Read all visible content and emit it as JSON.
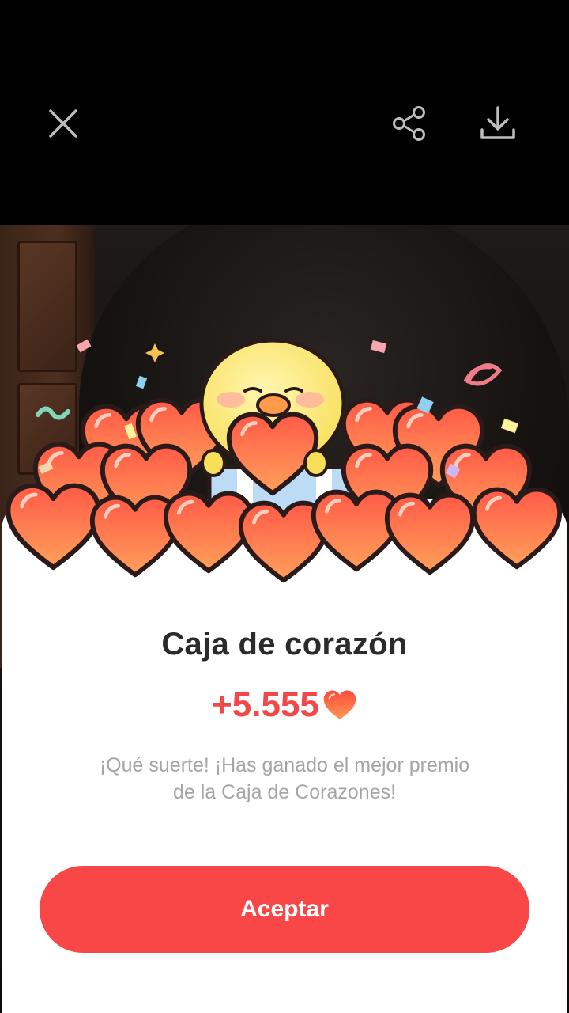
{
  "toolbar": {
    "close_icon": "close-icon",
    "share_icon": "share-icon",
    "download_icon": "download-icon"
  },
  "reward": {
    "title": "Caja de corazón",
    "amount": "+5.555",
    "currency_icon": "heart-icon",
    "message": "¡Qué suerte! ¡Has ganado el mejor premio de la Caja de Corazones!",
    "accept_label": "Aceptar"
  },
  "colors": {
    "accent": "#f94747",
    "amount": "#f2484a",
    "title": "#2b2b2b",
    "message": "#a5a5a5"
  }
}
